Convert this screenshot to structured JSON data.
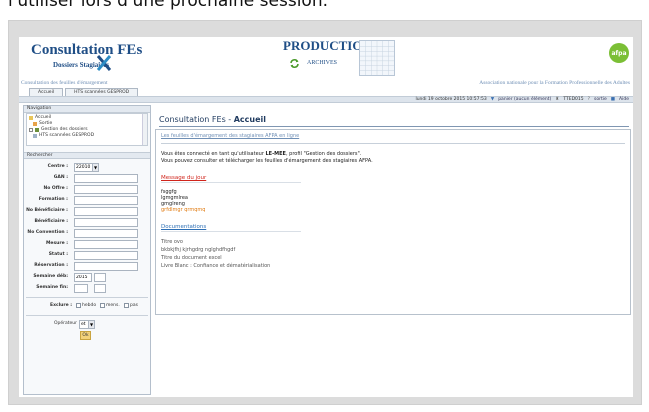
{
  "caption": "l'utiliser lors d'une prochaine session.",
  "header": {
    "app_title": "Consultation FEs",
    "app_subtitle": "Dossiers Stagiaires",
    "production_label": "PRODUCTION",
    "archives_label": "ARCHIVES",
    "logo_text": "afpa",
    "tagline_left": "Consultation des feuilles d'émargement",
    "tagline_right": "Association nationale pour la Formation Professionnelle des Adultes"
  },
  "tabs": [
    {
      "label": "Accueil"
    },
    {
      "label": "HTS scannées GESPROD"
    }
  ],
  "statusbar": {
    "datetime": "lundi 19 octobre 2015 10:57:53",
    "basket": "panier (aucun élément)",
    "user_code": "TTED015",
    "logout": "sortie",
    "help": "Aide"
  },
  "sidebar": {
    "navigation_title": "Navigation",
    "nav_items": [
      {
        "label": "Accueil"
      },
      {
        "label": "Sortie"
      },
      {
        "label": "Gestion des dossiers"
      },
      {
        "label": "HTS scannées GESPROD"
      }
    ],
    "search_title": "Rechercher",
    "fields": {
      "centre_label": "Centre :",
      "centre_value": "22010",
      "gan_label": "GAN :",
      "no_offre_label": "No Offre :",
      "formation_label": "Formation :",
      "no_beneficiaire_label": "No Bénéficiaire :",
      "beneficiaire_label": "Bénéficiaire :",
      "no_convention_label": "No Convention :",
      "mesure_label": "Mesure :",
      "statut_label": "Statut :",
      "reservation_label": "Réservation :",
      "semaine_deb_label": "Semaine déb:",
      "semaine_deb_value": "2015",
      "semaine_fin_label": "Semaine fin:"
    },
    "exclure_label": "Exclure :",
    "exclure_options": [
      {
        "label": "hebdo"
      },
      {
        "label": "mens."
      },
      {
        "label": "pas"
      }
    ],
    "operateur_label": "Opérateur :",
    "operateur_value": "et",
    "ok_label": "Ok"
  },
  "main": {
    "title_prefix": "Consultation FEs - ",
    "title_bold": "Accueil",
    "panel_heading": "Les feuilles d'émargement des stagiaires AFPA en ligne",
    "intro_line1_before": "Vous êtes connecté en tant qu'utilisateur ",
    "intro_user": "LE-MEE",
    "intro_line1_after": ", profil \"Gestion des dossiers\".",
    "intro_line2": "Vous pouvez consulter et télécharger les feuilles d'émargement des stagiaires AFPA.",
    "message_heading": "Message du jour",
    "messages": [
      {
        "text": "fsggfg"
      },
      {
        "text": "lgmgmlrea"
      },
      {
        "text": "gmglreng"
      },
      {
        "text": "grfdlmgr qrmqmq"
      }
    ],
    "docs_heading": "Documentations",
    "docs": [
      {
        "text": "Titre ovo"
      },
      {
        "text": "bkbkjfhj kjrhgdrg nglghdfhgdf"
      },
      {
        "text": "Titre du document excel"
      },
      {
        "text": "Livre Blanc : Confiance et dématérialisation"
      }
    ]
  },
  "colors": {
    "brand_blue": "#1f4e86",
    "message_red": "#d0241b",
    "link_blue": "#2d6fb5",
    "accent_green": "#7bbf35",
    "highlight_orange": "#e07a10"
  }
}
